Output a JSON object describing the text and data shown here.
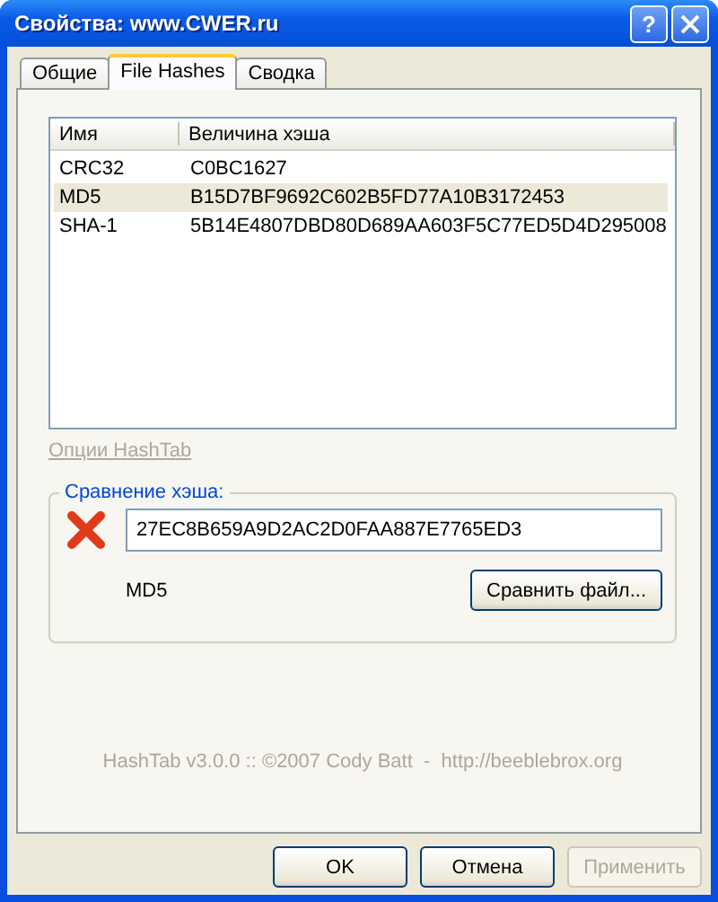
{
  "window": {
    "title": "Свойства: www.CWER.ru",
    "help_button": "?"
  },
  "tabs": [
    {
      "label": "Общие",
      "selected": false
    },
    {
      "label": "File Hashes",
      "selected": true
    },
    {
      "label": "Сводка",
      "selected": false
    }
  ],
  "hash_list": {
    "columns": [
      "Имя",
      "Величина хэша"
    ],
    "rows": [
      {
        "name": "CRC32",
        "value": "C0BC1627",
        "selected": false
      },
      {
        "name": "MD5",
        "value": "B15D7BF9692C602B5FD77A10B3172453",
        "selected": true
      },
      {
        "name": "SHA-1",
        "value": "5B14E4807DBD80D689AA603F5C77ED5D4D295008",
        "selected": false
      }
    ]
  },
  "options_link": "Опции HashTab",
  "compare": {
    "legend": "Сравнение хэша:",
    "matched": false,
    "value": "27EC8B659A9D2AC2D0FAA887E7765ED3",
    "hash_type": "MD5",
    "button": "Сравнить файл..."
  },
  "footer": "HashTab v3.0.0 :: ©2007 Cody Batt  -  http://beeblebrox.org",
  "buttons": [
    {
      "label": "OK",
      "disabled": false
    },
    {
      "label": "Отмена",
      "disabled": false
    },
    {
      "label": "Применить",
      "disabled": true
    }
  ]
}
